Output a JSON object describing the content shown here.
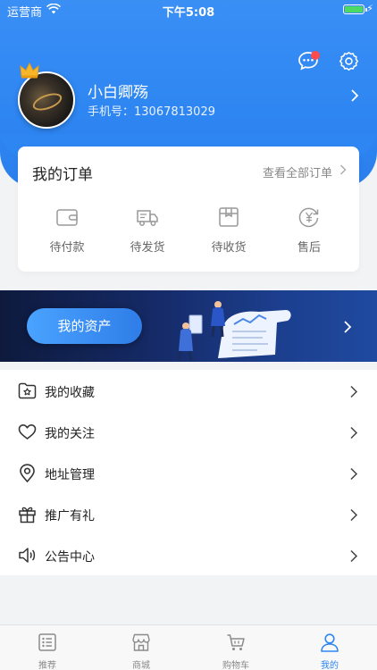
{
  "status_bar": {
    "carrier": "运营商",
    "time": "下午5:08"
  },
  "profile": {
    "name": "小白卿殇",
    "phone": "手机号：13067813029"
  },
  "orders": {
    "title": "我的订单",
    "view_all": "查看全部订单",
    "items": [
      {
        "label": "待付款",
        "icon": "wallet-icon"
      },
      {
        "label": "待发货",
        "icon": "truck-icon"
      },
      {
        "label": "待收货",
        "icon": "package-icon"
      },
      {
        "label": "售后",
        "icon": "refund-icon"
      }
    ]
  },
  "banner": {
    "button_label": "我的资产"
  },
  "menu": [
    {
      "label": "我的收藏",
      "icon": "star-folder-icon"
    },
    {
      "label": "我的关注",
      "icon": "heart-icon"
    },
    {
      "label": "地址管理",
      "icon": "location-icon"
    },
    {
      "label": "推广有礼",
      "icon": "gift-icon"
    },
    {
      "label": "公告中心",
      "icon": "speaker-icon"
    }
  ],
  "tabbar": [
    {
      "label": "推荐",
      "icon": "list-icon",
      "active": false
    },
    {
      "label": "商城",
      "icon": "store-icon",
      "active": false
    },
    {
      "label": "购物车",
      "icon": "cart-icon",
      "active": false
    },
    {
      "label": "我的",
      "icon": "user-icon",
      "active": true
    }
  ],
  "colors": {
    "primary": "#2e86f2",
    "badge": "#ff4b4b",
    "banner_dark": "#0e1a3d"
  }
}
